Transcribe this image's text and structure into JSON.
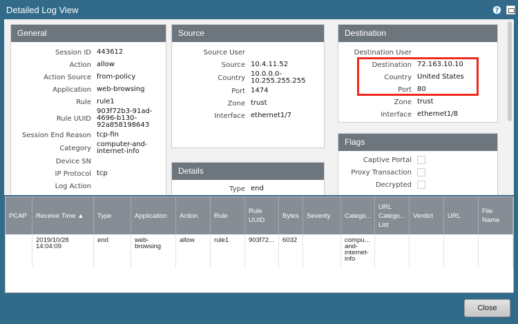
{
  "window": {
    "title": "Detailed Log View",
    "help_icon": "?"
  },
  "general": {
    "title": "General",
    "rows": [
      {
        "label": "Session ID",
        "value": "443612"
      },
      {
        "label": "Action",
        "value": "allow"
      },
      {
        "label": "Action Source",
        "value": "from-policy"
      },
      {
        "label": "Application",
        "value": "web-browsing"
      },
      {
        "label": "Rule",
        "value": "rule1"
      },
      {
        "label": "Rule UUID",
        "value": "903f72b3-91ad-4696-b130-92a858198643"
      },
      {
        "label": "Session End Reason",
        "value": "tcp-fin"
      },
      {
        "label": "Category",
        "value": "computer-and-internet-info"
      },
      {
        "label": "Device SN",
        "value": ""
      },
      {
        "label": "IP Protocol",
        "value": "tcp"
      },
      {
        "label": "Log Action",
        "value": ""
      }
    ]
  },
  "source": {
    "title": "Source",
    "rows": [
      {
        "label": "Source User",
        "value": ""
      },
      {
        "label": "Source",
        "value": "10.4.11.52"
      },
      {
        "label": "Country",
        "value": "10.0.0.0-10.255.255.255"
      },
      {
        "label": "Port",
        "value": "1474"
      },
      {
        "label": "Zone",
        "value": "trust"
      },
      {
        "label": "Interface",
        "value": "ethernet1/7"
      }
    ]
  },
  "details": {
    "title": "Details",
    "rows": [
      {
        "label": "Type",
        "value": "end"
      }
    ]
  },
  "destination": {
    "title": "Destination",
    "rows": [
      {
        "label": "Destination User",
        "value": ""
      },
      {
        "label": "Destination",
        "value": "72.163.10.10"
      },
      {
        "label": "Country",
        "value": "United States"
      },
      {
        "label": "Port",
        "value": "80"
      },
      {
        "label": "Zone",
        "value": "trust"
      },
      {
        "label": "Interface",
        "value": "ethernet1/8"
      }
    ]
  },
  "flags": {
    "title": "Flags",
    "rows": [
      {
        "label": "Captive Portal"
      },
      {
        "label": "Proxy Transaction"
      },
      {
        "label": "Decrypted"
      }
    ]
  },
  "table": {
    "columns": [
      "PCAP",
      "Receive Time ▲",
      "Type",
      "Application",
      "Action",
      "Rule",
      "Rule UUID",
      "Bytes",
      "Severity",
      "Catego...",
      "URL Catego... List",
      "Verdict",
      "URL",
      "File Name"
    ],
    "rows": [
      [
        "",
        "2019/10/28 14:04:09",
        "end",
        "web-browsing",
        "allow",
        "rule1",
        "903f72...",
        "6032",
        "",
        "compu... and-internet-info",
        "",
        "",
        "",
        ""
      ]
    ]
  },
  "buttons": {
    "close": "Close"
  },
  "colors": {
    "highlight": "#f0281e",
    "frame": "#326a89"
  }
}
